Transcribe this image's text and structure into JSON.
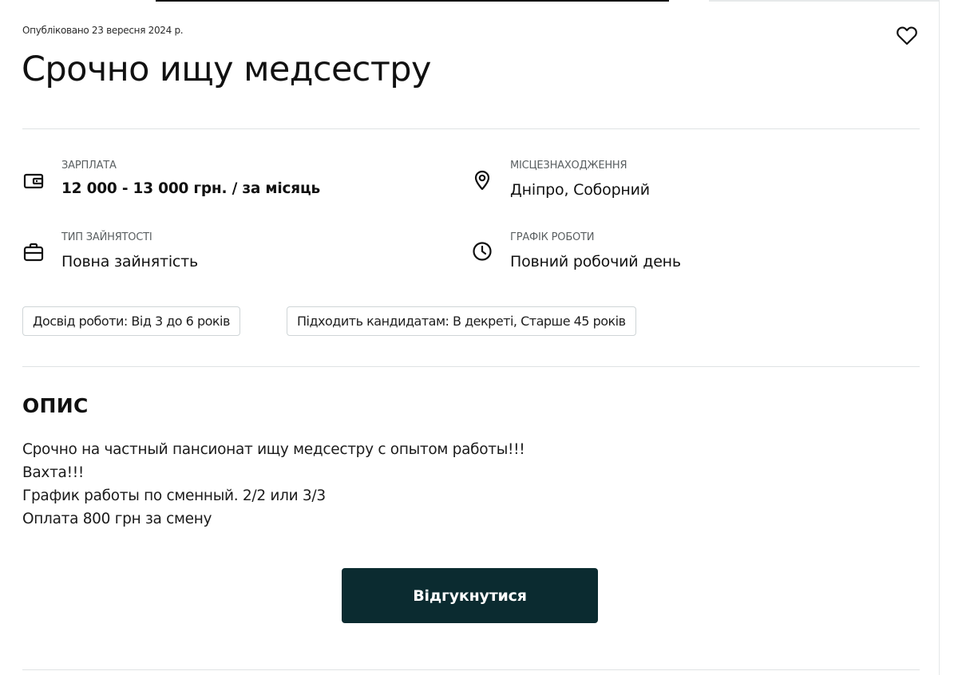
{
  "vacancy": {
    "published": "Опубліковано 23 вересня 2024 р.",
    "title": "Срочно ищу медсестру",
    "favorite_icon": "heart-outline-icon"
  },
  "info": [
    {
      "key": "salary",
      "icon": "wallet-icon",
      "label": "ЗАРПЛАТА",
      "value": "12 000 - 13 000 грн. / за місяць"
    },
    {
      "key": "location",
      "icon": "location-pin-icon",
      "label": "МІСЦЕЗНАХОДЖЕННЯ",
      "value": "Дніпро, Соборний"
    },
    {
      "key": "employment",
      "icon": "briefcase-icon",
      "label": "ТИП ЗАЙНЯТОСТІ",
      "value": "Повна зайнятість"
    },
    {
      "key": "schedule",
      "icon": "clock-icon",
      "label": "ГРАФІК РОБОТИ",
      "value": "Повний робочий день"
    }
  ],
  "tags": [
    "Досвід роботи: Від 3 до 6 років",
    "Підходить кандидатам: В декреті, Старше 45 років"
  ],
  "description": {
    "heading": "ОПИС",
    "lines": [
      "Срочно на частный пансионат ищу медсестру с опытом работы!!!",
      "Вахта!!!",
      "График работы по сменный. 2/2 или 3/3",
      "Оплата 800 грн за смену"
    ]
  },
  "actions": {
    "apply_label": "Відгукнутися",
    "apply_color": "#0b2b30"
  }
}
